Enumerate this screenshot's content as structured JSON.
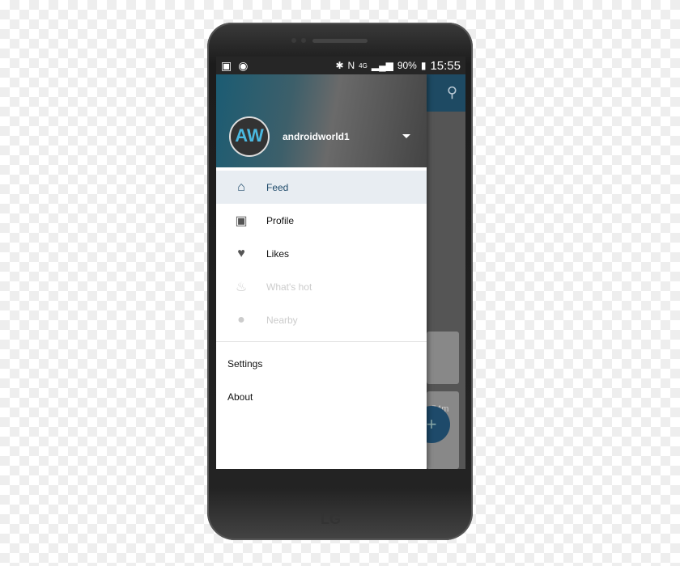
{
  "status_bar": {
    "battery": "90%",
    "time": "15:55",
    "icons": [
      "image-icon",
      "android-icon",
      "bluetooth-icon",
      "nfc-icon",
      "4g-icon",
      "signal-icon",
      "battery-icon"
    ]
  },
  "drawer": {
    "username": "androidworld1",
    "avatar_text": "AW",
    "items": [
      {
        "label": "Feed",
        "icon": "home-icon",
        "active": true
      },
      {
        "label": "Profile",
        "icon": "profile-icon"
      },
      {
        "label": "Likes",
        "icon": "heart-icon"
      },
      {
        "label": "What's hot",
        "icon": "fire-icon",
        "disabled": true
      },
      {
        "label": "Nearby",
        "icon": "location-icon",
        "disabled": true
      }
    ],
    "secondary": [
      {
        "label": "Settings"
      },
      {
        "label": "About"
      }
    ]
  },
  "background_app": {
    "timestamp": "54m",
    "fab": "+"
  },
  "device": {
    "brand": "LG"
  },
  "colors": {
    "accent": "#1e4a6a",
    "active_bg": "#e8edf2"
  }
}
